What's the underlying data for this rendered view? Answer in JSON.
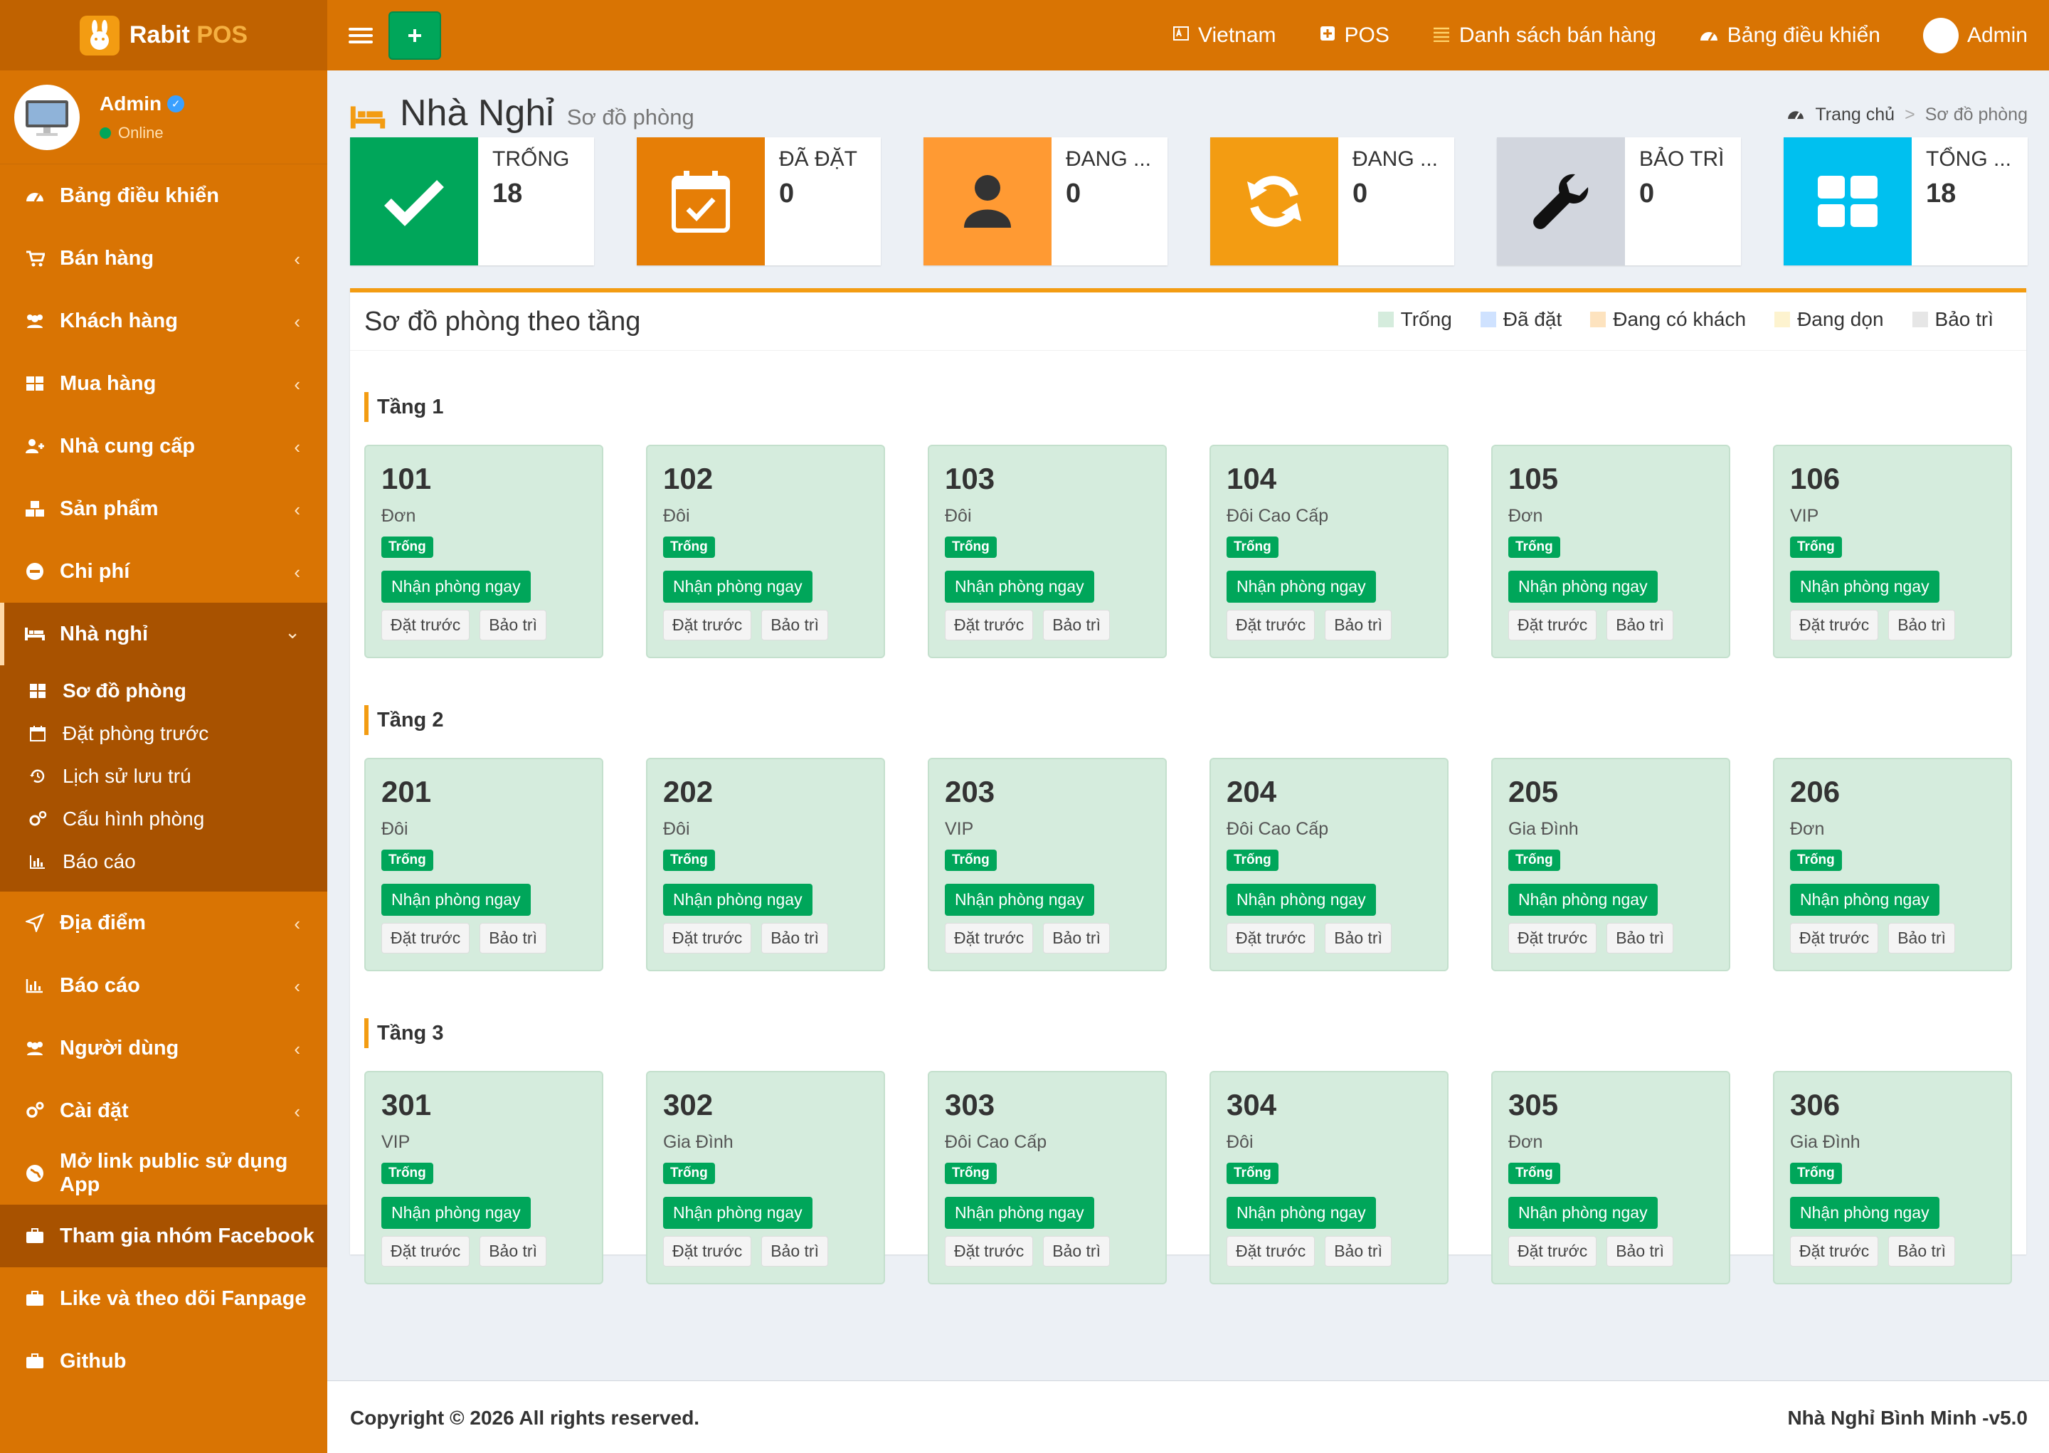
{
  "app": {
    "name_part1": "Rabit",
    "name_part2": "POS"
  },
  "user": {
    "name": "Admin",
    "status": "Online"
  },
  "sidebar": {
    "items": [
      {
        "label": "Bảng điều khiển",
        "icon": "dashboard-icon"
      },
      {
        "label": "Bán hàng",
        "icon": "cart-icon"
      },
      {
        "label": "Khách hàng",
        "icon": "users-icon"
      },
      {
        "label": "Mua hàng",
        "icon": "grid-icon"
      },
      {
        "label": "Nhà cung cấp",
        "icon": "user-plus-icon"
      },
      {
        "label": "Sản phẩm",
        "icon": "cubes-icon"
      },
      {
        "label": "Chi phí",
        "icon": "minus-circle-icon"
      },
      {
        "label": "Nhà nghỉ",
        "icon": "bed-icon"
      }
    ],
    "sub_items": [
      {
        "label": "Sơ đồ phòng",
        "icon": "grid-icon"
      },
      {
        "label": "Đặt phòng trước",
        "icon": "calendar-icon"
      },
      {
        "label": "Lịch sử lưu trú",
        "icon": "history-icon"
      },
      {
        "label": "Cấu hình phòng",
        "icon": "gears-icon"
      },
      {
        "label": "Báo cáo",
        "icon": "bar-chart-icon"
      }
    ],
    "items2": [
      {
        "label": "Địa điểm",
        "icon": "location-arrow-icon"
      },
      {
        "label": "Báo cáo",
        "icon": "bar-chart-icon"
      },
      {
        "label": "Người dùng",
        "icon": "users-icon"
      },
      {
        "label": "Cài đặt",
        "icon": "gears-icon"
      },
      {
        "label": "Mở link public sử dụng App",
        "icon": "globe-icon"
      },
      {
        "label": "Tham gia nhóm Facebook",
        "icon": "briefcase-icon"
      },
      {
        "label": "Like và theo dõi Fanpage",
        "icon": "briefcase-icon"
      },
      {
        "label": "Github",
        "icon": "briefcase-icon"
      }
    ]
  },
  "topnav": {
    "language": "Vietnam",
    "pos": "POS",
    "sales_list": "Danh sách bán hàng",
    "dashboard": "Bảng điều khiển",
    "admin": "Admin"
  },
  "header": {
    "title": "Nhà Nghỉ",
    "subtitle": "Sơ đồ phòng"
  },
  "breadcrumb": {
    "home": "Trang chủ",
    "sep": ">",
    "current": "Sơ đồ phòng"
  },
  "stats": [
    {
      "label": "TRỐNG",
      "value": "18",
      "color": "#00a65a",
      "icon": "check-icon"
    },
    {
      "label": "ĐÃ ĐẶT",
      "value": "0",
      "color": "#e67e06",
      "icon": "calendar-check-icon"
    },
    {
      "label": "ĐANG ...",
      "value": "0",
      "color": "#ff9a33",
      "icon": "user-icon"
    },
    {
      "label": "ĐANG ...",
      "value": "0",
      "color": "#f39c12",
      "icon": "refresh-icon"
    },
    {
      "label": "BẢO TRÌ",
      "value": "0",
      "color": "#d2d6de",
      "icon": "wrench-icon"
    },
    {
      "label": "TỔNG ...",
      "value": "18",
      "color": "#00c0ef",
      "icon": "th-large-icon"
    }
  ],
  "panel": {
    "title": "Sơ đồ phòng theo tầng"
  },
  "legend": [
    {
      "label": "Trống",
      "color": "#d5ecdd"
    },
    {
      "label": "Đã đặt",
      "color": "#cfe2ff"
    },
    {
      "label": "Đang có khách",
      "color": "#fde3bf"
    },
    {
      "label": "Đang dọn",
      "color": "#fdf3cf"
    },
    {
      "label": "Bảo trì",
      "color": "#e6e6e6"
    }
  ],
  "room_labels": {
    "status": "Trống",
    "checkin": "Nhận phòng ngay",
    "book": "Đặt trước",
    "maintain": "Bảo trì"
  },
  "floors": [
    {
      "title": "Tầng 1",
      "rooms": [
        {
          "number": "101",
          "type": "Đơn"
        },
        {
          "number": "102",
          "type": "Đôi"
        },
        {
          "number": "103",
          "type": "Đôi"
        },
        {
          "number": "104",
          "type": "Đôi Cao Cấp"
        },
        {
          "number": "105",
          "type": "Đơn"
        },
        {
          "number": "106",
          "type": "VIP"
        }
      ]
    },
    {
      "title": "Tầng 2",
      "rooms": [
        {
          "number": "201",
          "type": "Đôi"
        },
        {
          "number": "202",
          "type": "Đôi"
        },
        {
          "number": "203",
          "type": "VIP"
        },
        {
          "number": "204",
          "type": "Đôi Cao Cấp"
        },
        {
          "number": "205",
          "type": "Gia Đình"
        },
        {
          "number": "206",
          "type": "Đơn"
        }
      ]
    },
    {
      "title": "Tầng 3",
      "rooms": [
        {
          "number": "301",
          "type": "VIP"
        },
        {
          "number": "302",
          "type": "Gia Đình"
        },
        {
          "number": "303",
          "type": "Đôi Cao Cấp"
        },
        {
          "number": "304",
          "type": "Đôi"
        },
        {
          "number": "305",
          "type": "Đơn"
        },
        {
          "number": "306",
          "type": "Gia Đình"
        }
      ]
    }
  ],
  "footer": {
    "copyright": "Copyright © 2026 All rights reserved.",
    "brand": "Nhà Nghỉ Bình Minh -v5.0"
  }
}
